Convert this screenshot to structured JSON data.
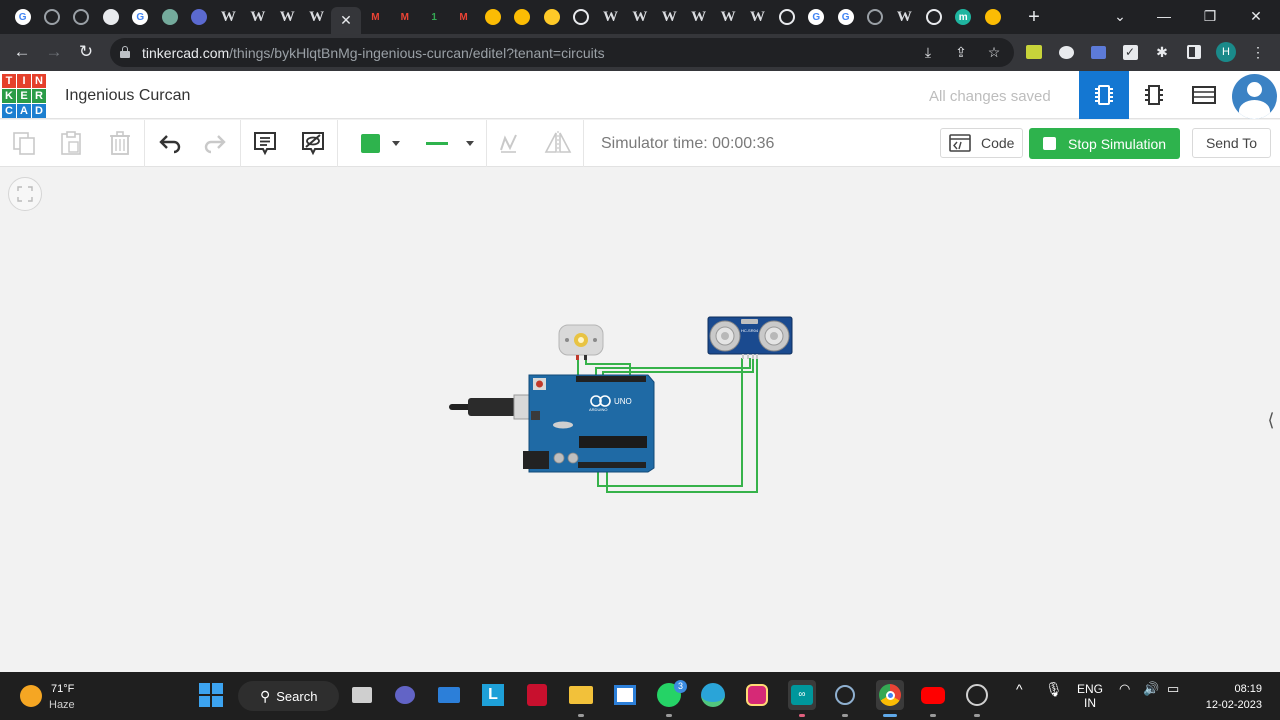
{
  "browser": {
    "tabs": [
      {
        "icon": "google-icon",
        "letter": "G",
        "color": "#4285f4"
      },
      {
        "icon": "badge-icon",
        "letter": "",
        "color": "#9aa0a6"
      },
      {
        "icon": "globe-icon",
        "letter": "",
        "color": "#9aa0a6"
      },
      {
        "icon": "doc-icon",
        "letter": "",
        "color": "#e8eaed"
      },
      {
        "icon": "google-icon",
        "letter": "G",
        "color": "#4285f4"
      },
      {
        "icon": "chatgpt-icon",
        "letter": "",
        "color": "#74aa9c"
      },
      {
        "icon": "radio-icon",
        "letter": "",
        "color": "#5b6ad0"
      },
      {
        "icon": "wikipedia-icon",
        "letter": "W",
        "color": ""
      },
      {
        "icon": "wikipedia-icon",
        "letter": "W",
        "color": ""
      },
      {
        "icon": "wikipedia-icon",
        "letter": "W",
        "color": ""
      },
      {
        "icon": "wikipedia-icon",
        "letter": "W",
        "color": ""
      },
      {
        "icon": "close-icon",
        "letter": "",
        "color": "",
        "active": true
      },
      {
        "icon": "gmail-icon",
        "letter": "M",
        "color": "#ea4335"
      },
      {
        "icon": "gmail-icon",
        "letter": "M",
        "color": "#ea4335"
      },
      {
        "icon": "one-icon",
        "letter": "1",
        "color": "#34a853"
      },
      {
        "icon": "gmail-icon",
        "letter": "M",
        "color": "#ea4335"
      },
      {
        "icon": "drive-icon",
        "letter": "",
        "color": "#fbbc04"
      },
      {
        "icon": "drive-icon",
        "letter": "",
        "color": "#fbbc04"
      },
      {
        "icon": "firebase-icon",
        "letter": "",
        "color": "#ffca28"
      },
      {
        "icon": "github-icon",
        "letter": "",
        "color": "#e8eaed"
      },
      {
        "icon": "wikipedia-icon",
        "letter": "W",
        "color": ""
      },
      {
        "icon": "wikipedia-icon",
        "letter": "W",
        "color": ""
      },
      {
        "icon": "wikipedia-icon",
        "letter": "W",
        "color": ""
      },
      {
        "icon": "wikipedia-icon",
        "letter": "W",
        "color": ""
      },
      {
        "icon": "wikipedia-icon",
        "letter": "W",
        "color": ""
      },
      {
        "icon": "wikipedia-icon",
        "letter": "W",
        "color": ""
      },
      {
        "icon": "github-icon",
        "letter": "",
        "color": "#e8eaed"
      },
      {
        "icon": "google-icon",
        "letter": "G",
        "color": "#4285f4"
      },
      {
        "icon": "google-icon",
        "letter": "G",
        "color": "#4285f4"
      },
      {
        "icon": "globe-icon",
        "letter": "",
        "color": "#9aa0a6"
      },
      {
        "icon": "wikipedia-icon",
        "letter": "W",
        "color": ""
      },
      {
        "icon": "gear-icon",
        "letter": "",
        "color": "#e8eaed"
      },
      {
        "icon": "m-icon",
        "letter": "m",
        "color": "#1fb5a0"
      },
      {
        "icon": "drive-icon",
        "letter": "",
        "color": "#fbbc04"
      }
    ],
    "url_host": "tinkercad.com",
    "url_path": "/things/bykHlqtBnMg-ingenious-curcan/editel?tenant=circuits",
    "profile_letter": "H"
  },
  "app": {
    "logo_letters": [
      "T",
      "I",
      "N",
      "K",
      "E",
      "R",
      "C",
      "A",
      "D"
    ],
    "logo_colors": [
      "#e5402b",
      "#e5402b",
      "#e5402b",
      "#2a9c47",
      "#2a9c47",
      "#2a9c47",
      "#1c7fd0",
      "#1c7fd0",
      "#1c7fd0"
    ],
    "project_title": "Ingenious Curcan",
    "save_status": "All changes saved"
  },
  "toolbar": {
    "simulator_time": "Simulator time: 00:00:36",
    "code_label": "Code",
    "stop_label": "Stop Simulation",
    "send_to_label": "Send To",
    "wire_color": "#2eb34d",
    "stop_color": "#2eb34d"
  },
  "circuit": {
    "components": [
      "DC Motor",
      "HC-SR04 Ultrasonic Sensor",
      "Arduino UNO"
    ],
    "sensor_label": "HC-SR04",
    "board_label": "UNO",
    "board_brand": "ARDUINO",
    "wire_color": "#36b24a"
  },
  "taskbar": {
    "temperature": "71°F",
    "condition": "Haze",
    "search_label": "Search",
    "whatsapp_badge": "3",
    "language_top": "ENG",
    "language_bottom": "IN",
    "time": "08:19",
    "date": "12-02-2023"
  }
}
